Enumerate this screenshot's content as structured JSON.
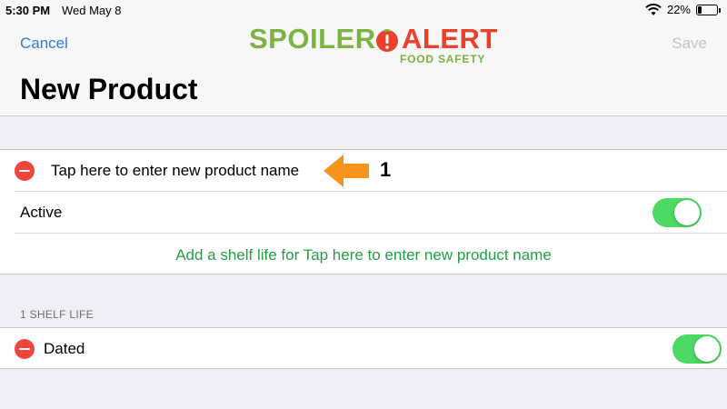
{
  "status_bar": {
    "time": "5:30 PM",
    "date": "Wed May 8",
    "battery_text": "22%",
    "battery_level": 0.22,
    "wifi_icon": "wifi-icon"
  },
  "nav": {
    "cancel_label": "Cancel",
    "save_label": "Save",
    "title": "New Product"
  },
  "logo": {
    "word1": "SPOILER",
    "word2": "ALERT",
    "tagline": "FOOD SAFETY"
  },
  "product_section": {
    "name_placeholder": "Tap here to enter new product name",
    "callout_number": "1",
    "active_label": "Active",
    "active_on": true,
    "add_shelf_life_label": "Add a shelf life for Tap here to enter new product name"
  },
  "shelf_life_section": {
    "header": "1 SHELF LIFE",
    "items": [
      {
        "label": "Dated",
        "enabled": true
      }
    ]
  },
  "colors": {
    "accent_blue": "#2f7ae5",
    "switch_green": "#4cd964",
    "delete_red": "#f0463b",
    "link_green": "#23a046",
    "arrow_orange": "#f7941d",
    "logo_green": "#7cb342",
    "logo_red": "#e8412c"
  }
}
